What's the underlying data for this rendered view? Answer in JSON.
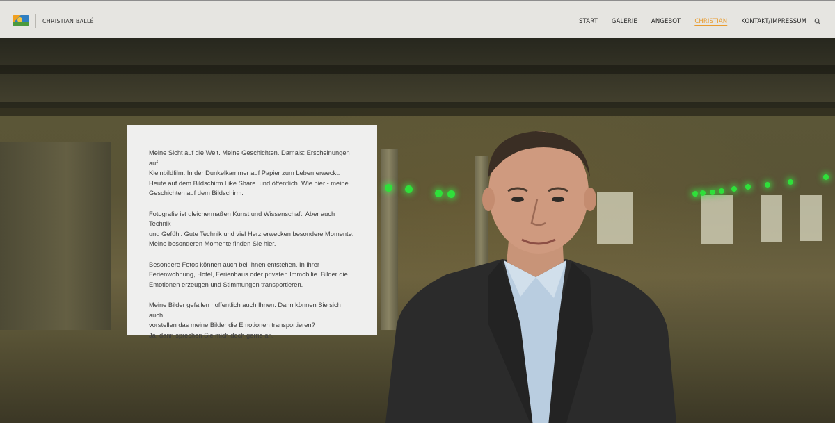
{
  "header": {
    "brand": "CHRISTIAN BALLÉ",
    "nav": [
      {
        "label": "START",
        "active": false
      },
      {
        "label": "GALERIE",
        "active": false
      },
      {
        "label": "ANGEBOT",
        "active": false
      },
      {
        "label": "CHRISTIAN",
        "active": true
      },
      {
        "label": "KONTAKT/IMPRESSUM",
        "active": false
      }
    ],
    "accent_color": "#e99c2f",
    "icons": {
      "logo": "camera-photo-logo-icon",
      "search": "search-icon"
    }
  },
  "hero": {
    "image": "portrait-man-in-dark-suit-in-parking-garage-with-green-lights",
    "paragraphs": [
      "Meine Sicht auf die Welt. Meine Geschichten. Damals: Erscheinungen auf\nKleinbildfilm. In der Dunkelkammer auf Papier zum Leben erweckt.\nHeute auf dem Bildschirm Like.Share. und öffentlich. Wie hier - meine\nGeschichten auf dem Bildschirm.",
      "Fotografie ist gleichermaßen Kunst und Wissenschaft. Aber auch Technik\nund Gefühl. Gute Technik und viel Herz erwecken besondere Momente.\nMeine besonderen Momente finden Sie hier.",
      "Besondere Fotos können auch bei Ihnen entstehen. In ihrer\nFerienwohnung, Hotel, Ferienhaus oder privaten Immobilie. Bilder die\nEmotionen erzeugen und Stimmungen transportieren.",
      "Meine Bilder gefallen hoffentlich auch Ihnen. Dann können Sie sich auch\nvorstellen das meine Bilder die Emotionen transportieren?\nJa, dann sprechen Sie mich doch gerne an."
    ]
  }
}
